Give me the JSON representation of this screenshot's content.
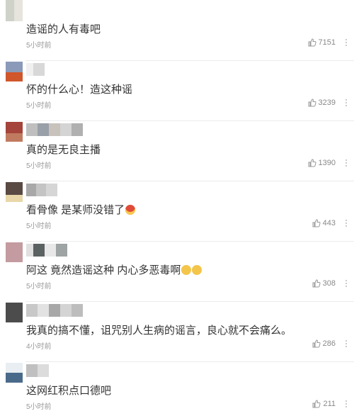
{
  "comments": [
    {
      "text": "造谣的人有毒吧",
      "time": "5小时前",
      "likes": "7151"
    },
    {
      "text": "怀的什么心！造这种谣",
      "time": "5小时前",
      "likes": "3239"
    },
    {
      "text": "真的是无良主播",
      "time": "5小时前",
      "likes": "1390"
    },
    {
      "text": "看骨像 是某师没错了",
      "time": "5小时前",
      "likes": "443"
    },
    {
      "text": "阿这 竟然造谣这种 内心多恶毒啊",
      "time": "5小时前",
      "likes": "308"
    },
    {
      "text": "我真的搞不懂，诅咒别人生病的谣言，良心就不会痛么。",
      "time": "4小时前",
      "likes": "286"
    },
    {
      "text": "这网红积点口德吧",
      "time": "5小时前",
      "likes": "211"
    }
  ]
}
